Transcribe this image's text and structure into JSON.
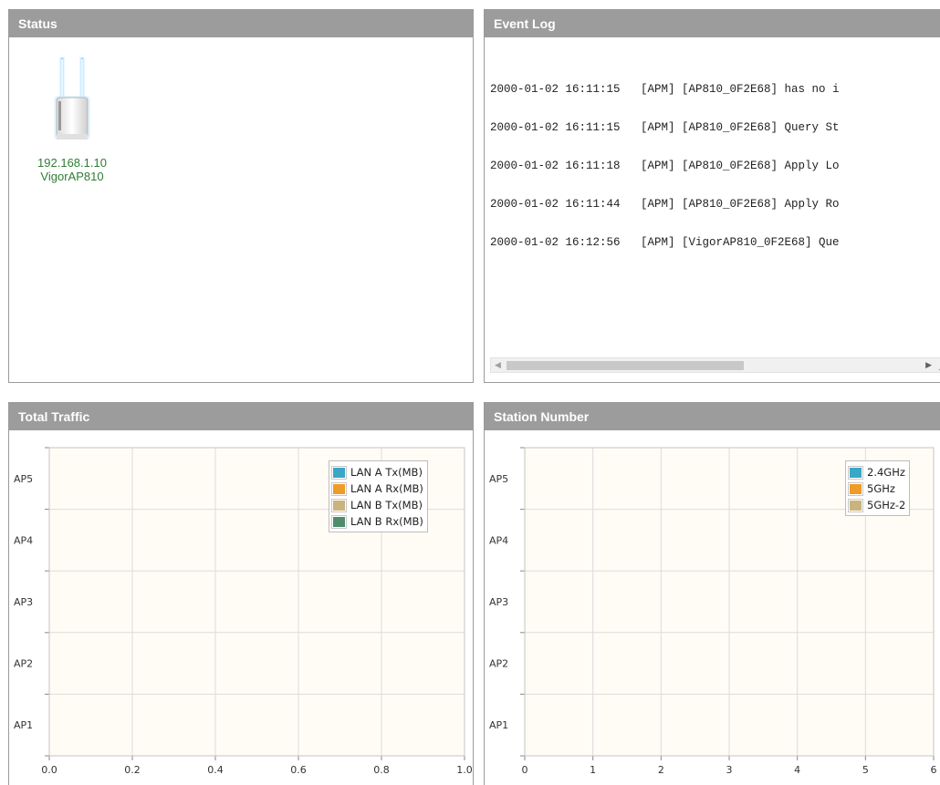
{
  "status": {
    "title": "Status",
    "device": {
      "ip": "192.168.1.10",
      "name": "VigorAP810",
      "icon": "access-point-icon"
    }
  },
  "event_log": {
    "title": "Event Log",
    "lines": [
      "2000-01-02 16:11:15   [APM] [AP810_0F2E68] has no i",
      "2000-01-02 16:11:15   [APM] [AP810_0F2E68] Query St",
      "2000-01-02 16:11:18   [APM] [AP810_0F2E68] Apply Lo",
      "2000-01-02 16:11:44   [APM] [AP810_0F2E68] Apply Ro",
      "2000-01-02 16:12:56   [APM] [VigorAP810_0F2E68] Que"
    ]
  },
  "total_traffic": {
    "title": "Total Traffic",
    "chart_data": {
      "type": "bar",
      "orientation": "horizontal",
      "categories": [
        "AP1",
        "AP2",
        "AP3",
        "AP4",
        "AP5"
      ],
      "x_ticks": [
        "0.0",
        "0.2",
        "0.4",
        "0.6",
        "0.8",
        "1.0"
      ],
      "xlim": [
        0,
        1.0
      ],
      "grid": true,
      "legend_position": "top-right",
      "series": [
        {
          "name": "LAN A Tx(MB)",
          "color": "#3aa7c7",
          "values": [
            0,
            0,
            0,
            0,
            0
          ]
        },
        {
          "name": "LAN A Rx(MB)",
          "color": "#ee9b27",
          "values": [
            0,
            0,
            0,
            0,
            0
          ]
        },
        {
          "name": "LAN B Tx(MB)",
          "color": "#c8b47c",
          "values": [
            0,
            0,
            0,
            0,
            0
          ]
        },
        {
          "name": "LAN B Rx(MB)",
          "color": "#4e8c6c",
          "values": [
            0,
            0,
            0,
            0,
            0
          ]
        }
      ]
    }
  },
  "station_number": {
    "title": "Station Number",
    "chart_data": {
      "type": "bar",
      "orientation": "horizontal",
      "categories": [
        "AP1",
        "AP2",
        "AP3",
        "AP4",
        "AP5"
      ],
      "x_ticks": [
        "0",
        "1",
        "2",
        "3",
        "4",
        "5",
        "6"
      ],
      "xlim": [
        0,
        6
      ],
      "grid": true,
      "legend_position": "top-right",
      "series": [
        {
          "name": "2.4GHz",
          "color": "#3aa7c7",
          "values": [
            0,
            0,
            0,
            0,
            0
          ]
        },
        {
          "name": "5GHz",
          "color": "#ee9b27",
          "values": [
            0,
            0,
            0,
            0,
            0
          ]
        },
        {
          "name": "5GHz-2",
          "color": "#c8b47c",
          "values": [
            0,
            0,
            0,
            0,
            0
          ]
        }
      ]
    }
  }
}
